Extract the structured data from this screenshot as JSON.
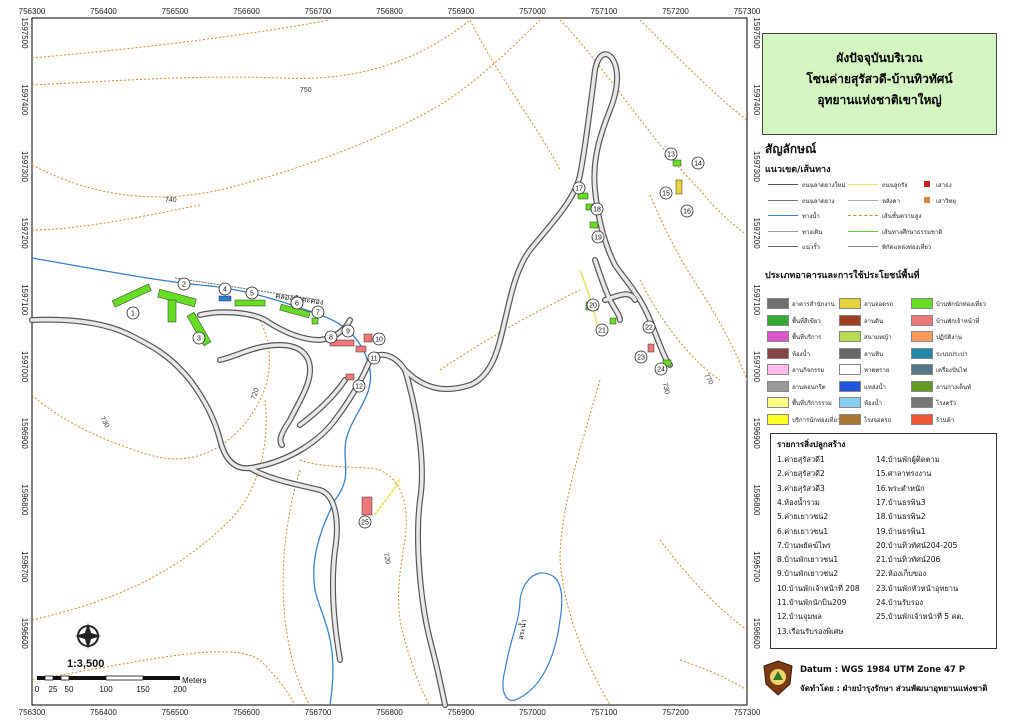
{
  "title": {
    "line1": "ผังปัจจุบันบริเวณ",
    "line2": "โซนค่ายสุรัสวดี-บ้านทิวทัศน์",
    "line3": "อุทยานแห่งชาติเขาใหญ่"
  },
  "legend": {
    "heading": "สัญลักษณ์",
    "lines_heading": "แนวเขต/เส้นทาง",
    "lines": [
      {
        "label": "ถนนลาดยางใหม่",
        "color": "#555555"
      },
      {
        "label": "ถนนลาดยาง",
        "color": "#777777"
      },
      {
        "label": "ทางน้ำ",
        "color": "#3b7fd0"
      },
      {
        "label": "ทางเดิน",
        "color": "#999999"
      },
      {
        "label": "แนวรั้ว",
        "color": "#666666"
      },
      {
        "label": "ถนนลูกรัง",
        "color": "#f0e060"
      },
      {
        "label": "หลังคา",
        "color": "#aaaaaa"
      },
      {
        "label": "เส้นชั้นความสูง",
        "color": "#d08a30"
      },
      {
        "label": "เส้นทางศึกษาธรรมชาติ",
        "color": "#66cc33"
      },
      {
        "label": "พิกัดแหล่งท่องเที่ยว",
        "color": "#888888"
      },
      {
        "label": "เสาธง",
        "color": "#cc2222"
      },
      {
        "label": "เสาวิทยุ",
        "color": "#cc8844"
      }
    ],
    "buildings_heading": "ประเภทอาคารและการใช้ประโยชน์พื้นที่",
    "building_types": [
      {
        "label": "อาคารสำนักงาน",
        "color": "#707070"
      },
      {
        "label": "ลานจอดรถ",
        "color": "#e6d23a"
      },
      {
        "label": "บ้านพักนักท่องเที่ยว",
        "color": "#66dd22"
      },
      {
        "label": "พื้นที่สีเขียว",
        "color": "#33aa33"
      },
      {
        "label": "ลานดิน",
        "color": "#a04020"
      },
      {
        "label": "บ้านพักเจ้าหน้าที่",
        "color": "#ee7777"
      },
      {
        "label": "พื้นที่บริการ",
        "color": "#dd55cc"
      },
      {
        "label": "สนามหญ้า",
        "color": "#bbdd55"
      },
      {
        "label": "ปฏิบัติงาน",
        "color": "#ff9a5a"
      },
      {
        "label": "ห้องน้ำ",
        "color": "#884444"
      },
      {
        "label": "ลานหิน",
        "color": "#666666"
      },
      {
        "label": "ระบบประปา",
        "color": "#2288aa"
      },
      {
        "label": "ลานกิจกรรม",
        "color": "#ffbbee"
      },
      {
        "label": "หาดทราย",
        "color": "#ffffff"
      },
      {
        "label": "เครื่องปั่นไฟ",
        "color": "#557788"
      },
      {
        "label": "ลานคอนกรีต",
        "color": "#999999"
      },
      {
        "label": "แหล่งน้ำ",
        "color": "#2255dd"
      },
      {
        "label": "ลานกางเต็นท์",
        "color": "#669922"
      },
      {
        "label": "พื้นที่บริการรวม",
        "color": "#ffff88"
      },
      {
        "label": "ห้องน้ำ",
        "color": "#88ccee"
      },
      {
        "label": "โรงครัว",
        "color": "#777777"
      },
      {
        "label": "บริการนักท่องเที่ยว",
        "color": "#ffff22"
      },
      {
        "label": "โรงจอดรถ",
        "color": "#aa7733"
      },
      {
        "label": "ร้านค้า",
        "color": "#ee5533"
      }
    ]
  },
  "building_list": {
    "title": "รายการสิ่งปลูกสร้าง",
    "col1": [
      "1.ค่ายสุรัสวดี1",
      "2.ค่ายสุรัสวดี2",
      "3.ค่ายสุรัสวดี3",
      "4.ห้องน้ำรวม",
      "5.ค่ายเยาวชน2",
      "6.ค่ายเยาวชน1",
      "7.บ้านพยัคฆ์ไพร",
      "8.บ้านพักเยาวชน1",
      "9.บ้านพักเยาวชน2",
      "10.บ้านพักเจ้าหน้าที่ 208",
      "11.บ้านพักนักบิน209",
      "12.บ้านจุมพล",
      "13.เรือนรับรองพิเศษ"
    ],
    "col2": [
      "14.บ้านพักผู้ติดตาม",
      "15.ศาลาทรงงาน",
      "16.พระตำหนัก",
      "17.บ้านธรพิน3",
      "18.บ้านธรพิน2",
      "19.บ้านธรพิน1",
      "20.บ้านทิวทัศน์204-205",
      "21.บ้านทิวทัศน์206",
      "22.ห้องเก็บของ",
      "23.บ้านพักหัวหน้าอุทยาน",
      "24.บ้านรับรอง",
      "25.บ้านพักเจ้าหน้าที่ 5 คต."
    ]
  },
  "datum": "Datum : WGS 1984 UTM Zone 47 P",
  "credit": "จัดทำโดย : ฝ่ายบำรุงรักษา ส่วนพัฒนาอุทยานแห่งชาติ",
  "scale": {
    "ratio": "1:3,500",
    "unit": "Meters",
    "ticks": [
      "0",
      "25",
      "50",
      "100",
      "150",
      "200"
    ]
  },
  "grid": {
    "x_labels": [
      "756300",
      "756400",
      "756500",
      "756600",
      "756700",
      "756800",
      "756900",
      "757000",
      "757100",
      "757200",
      "757300"
    ],
    "y_labels": [
      "1597500",
      "1597400",
      "1597300",
      "1597200",
      "1597100",
      "1597000",
      "1596900",
      "1596800",
      "1596700",
      "1596600"
    ]
  },
  "contour_labels": [
    "750",
    "740",
    "730",
    "720",
    "720",
    "730",
    "770"
  ],
  "features": {
    "canal": "คลองลำตะคอง",
    "reservoir": "สระน้ำ",
    "markers": [
      "1",
      "2",
      "3",
      "4",
      "5",
      "6",
      "7",
      "8",
      "9",
      "10",
      "11",
      "12",
      "13",
      "14",
      "15",
      "16",
      "17",
      "18",
      "19",
      "20",
      "21",
      "22",
      "23",
      "24",
      "25"
    ]
  }
}
